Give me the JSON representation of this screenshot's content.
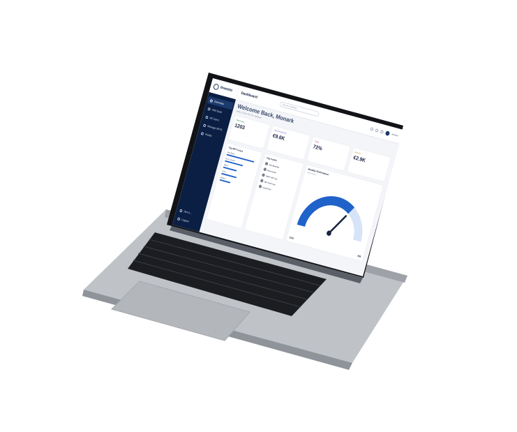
{
  "app": {
    "name": "Investo",
    "breadcrumb": "Dashboard"
  },
  "sidebar": {
    "items": [
      {
        "label": "Overview",
        "icon": "grid-icon",
        "active": true
      },
      {
        "label": "Add Goal",
        "icon": "goal-icon"
      },
      {
        "label": "All Users",
        "icon": "users-icon"
      },
      {
        "label": "Manage MFTs",
        "icon": "briefcase-icon"
      },
      {
        "label": "Profile",
        "icon": "profile-icon"
      }
    ],
    "bottom": [
      {
        "label": "Ask A...",
        "icon": "chat-icon"
      },
      {
        "label": "Logout",
        "icon": "logout-icon"
      }
    ]
  },
  "topbar": {
    "search_placeholder": "Search anything...",
    "user_name": "Monark"
  },
  "welcome": {
    "title": "Welcome Back, Monark",
    "subtitle": "Today, Check All Your Updates"
  },
  "stats": [
    {
      "title": "Total Users",
      "value": "1203",
      "note": ""
    },
    {
      "title": "Total Investment",
      "value": "€9.6K",
      "note": ""
    },
    {
      "title": "Goals",
      "value": "72%",
      "note": "",
      "negative": true
    },
    {
      "title": "Returns",
      "value": "€2.9K",
      "note": ""
    }
  ],
  "top_mf": {
    "title": "Top MFT Users",
    "funds": [
      {
        "name": "Axis Bank",
        "fill": 0.9
      },
      {
        "name": "Zero Growth",
        "fill": 0.6
      },
      {
        "name": "HDFC",
        "fill": 0.45
      },
      {
        "name": "ICICI",
        "fill": 0.5
      },
      {
        "name": "Nippon",
        "fill": 0.35
      }
    ]
  },
  "top_funds": {
    "title": "Top Funds",
    "items": [
      "Axis Bluechip",
      "Mirae Asset",
      "HDFC Mid Cap",
      "SBI Small Cap",
      "Kotak Flexi"
    ]
  },
  "gauge": {
    "title": "Monthly Performance",
    "selector": "Select Month",
    "min": "1225",
    "max": "985",
    "value": 0.68
  }
}
